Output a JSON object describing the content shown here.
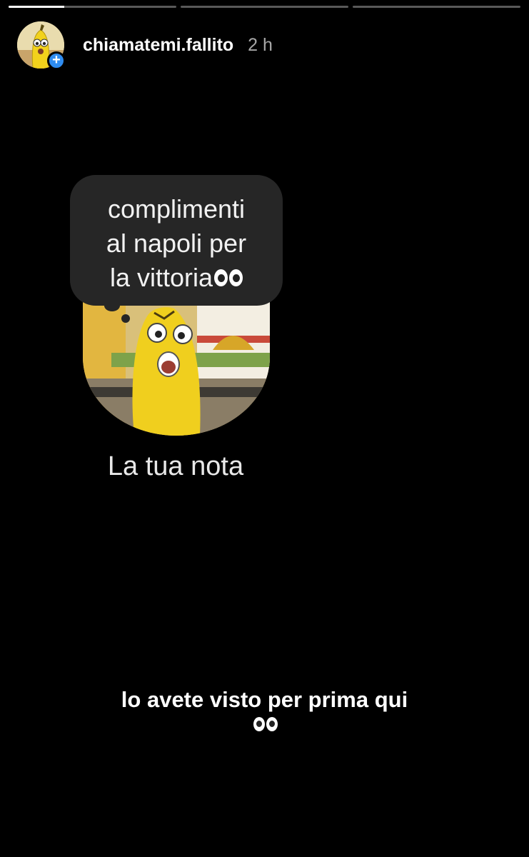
{
  "story": {
    "progress": [
      {
        "fill_fraction": 0.33
      },
      {
        "fill_fraction": 0
      },
      {
        "fill_fraction": 0
      }
    ],
    "username": "chiamatemi.fallito",
    "time": "2 h",
    "add_icon": "plus-icon",
    "accent_color": "#2f8cf0"
  },
  "note": {
    "lines": [
      "complimenti",
      "al napoli per",
      "la vittoria"
    ],
    "emoji": "eyes-emoji",
    "label": "La tua nota"
  },
  "caption": {
    "text": "lo avete visto per prima qui",
    "emoji": "eyes-emoji"
  }
}
